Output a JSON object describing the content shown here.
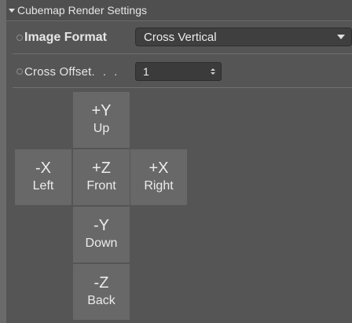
{
  "section": {
    "title": "Cubemap Render Settings"
  },
  "image_format": {
    "label": "Image Format",
    "value": "Cross Vertical"
  },
  "cross_offset": {
    "label": "Cross Offset",
    "dots": ". . .",
    "value": "1"
  },
  "faces": {
    "pos_y": {
      "axis": "+Y",
      "name": "Up"
    },
    "neg_x": {
      "axis": "-X",
      "name": "Left"
    },
    "pos_z": {
      "axis": "+Z",
      "name": "Front"
    },
    "pos_x": {
      "axis": "+X",
      "name": "Right"
    },
    "neg_y": {
      "axis": "-Y",
      "name": "Down"
    },
    "neg_z": {
      "axis": "-Z",
      "name": "Back"
    }
  }
}
